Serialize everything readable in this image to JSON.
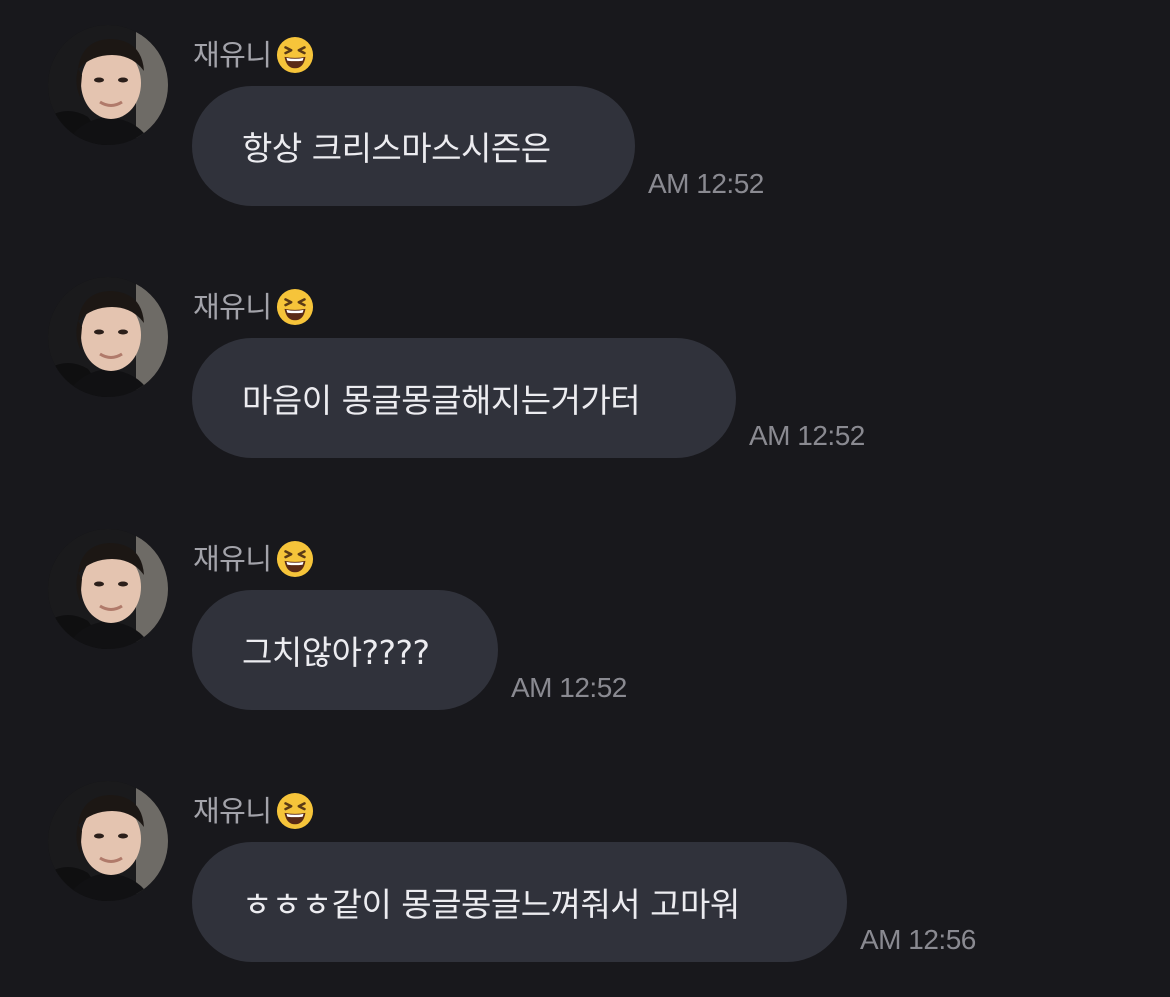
{
  "chat": {
    "messages": [
      {
        "sender": "재유니",
        "sender_emoji": "grinning-squinting-face-emoji",
        "text": "항상 크리스마스시즌은",
        "time": "AM 12:52"
      },
      {
        "sender": "재유니",
        "sender_emoji": "grinning-squinting-face-emoji",
        "text": "마음이 몽글몽글해지는거가터",
        "time": "AM 12:52"
      },
      {
        "sender": "재유니",
        "sender_emoji": "grinning-squinting-face-emoji",
        "text": "그치않아????",
        "time": "AM 12:52"
      },
      {
        "sender": "재유니",
        "sender_emoji": "grinning-squinting-face-emoji",
        "text": "ㅎㅎㅎ같이 몽글몽글느껴줘서 고마워",
        "time": "AM 12:56"
      }
    ]
  },
  "colors": {
    "background": "#18181c",
    "bubble": "#30323b",
    "message_text": "#ececf0",
    "sender_text": "#a3a3aa",
    "timestamp_text": "#8a8a91"
  }
}
